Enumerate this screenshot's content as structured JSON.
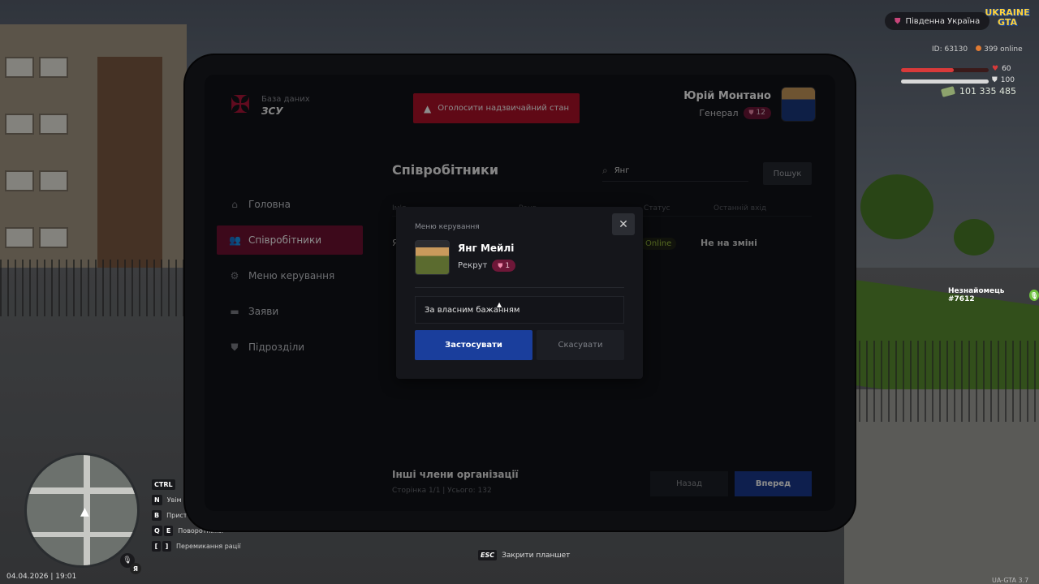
{
  "hud": {
    "region": "Південна Україна",
    "logo": "UKRAINE GTA",
    "player_id": "ID: 63130",
    "online": "399 online",
    "health": 60,
    "armor": 100,
    "money": "101 335 485",
    "nearby_player": "Незнайомець #7612",
    "datetime": "04.04.2026 | 19:01",
    "version": "UA-GTA 3.7",
    "esc_key": "ESC",
    "esc_label": "Закрити планшет",
    "hotkeys": [
      {
        "key": "CTRL",
        "label": ""
      },
      {
        "key": "N",
        "label": "Увім"
      },
      {
        "key": "B",
        "label": "Присте"
      },
      {
        "key": "Q",
        "key2": "E",
        "label": "Поворотники"
      },
      {
        "key": "[",
        "key2": "]",
        "label": "Перемикання рації"
      }
    ]
  },
  "tablet": {
    "brand": {
      "subtitle": "База даних",
      "title": "ЗСУ"
    },
    "emergency_button": "Оголосити надзвичайний стан",
    "user": {
      "name": "Юрій Монтано",
      "rank": "Генерал",
      "rank_level": "12"
    },
    "nav": [
      {
        "label": "Головна",
        "icon": "home-icon",
        "active": false
      },
      {
        "label": "Співробітники",
        "icon": "users-icon",
        "active": true
      },
      {
        "label": "Меню керування",
        "icon": "gear-icon",
        "active": false
      },
      {
        "label": "Заяви",
        "icon": "folder-icon",
        "active": false
      },
      {
        "label": "Підрозділи",
        "icon": "shield-icon",
        "active": false
      }
    ],
    "page_title": "Співробітники",
    "search": {
      "value": "Янг",
      "button": "Пошук"
    },
    "table": {
      "headers": [
        "Ім'я",
        "Ранг",
        "Статус",
        "Останній вхід"
      ],
      "rows": [
        {
          "name": "Я",
          "status": "Online",
          "last_login": "Не на зміні"
        }
      ]
    },
    "footer": {
      "title": "Інші члени організації",
      "subtitle": "Сторінка 1/1 | Усього: 132",
      "back": "Назад",
      "next": "Вперед"
    }
  },
  "modal": {
    "label": "Меню керування",
    "name": "Янг Мейлі",
    "rank": "Рекрут",
    "rank_level": "1",
    "reason_value": "За власним бажанням",
    "apply": "Застосувати",
    "cancel": "Скасувати"
  },
  "colors": {
    "accent_red": "#b01229",
    "active_nav": "#6f1232",
    "primary_blue": "#1a3e9c",
    "online_green": "#9cbf3d"
  }
}
